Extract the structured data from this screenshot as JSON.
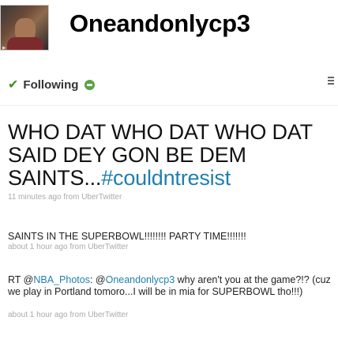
{
  "profile": {
    "username": "Oneandonlycp3",
    "following_label": "Following"
  },
  "tweets": [
    {
      "prefix": "WHO DAT WHO DAT WHO DAT SAID DEY GON BE DEM SAINTS...",
      "hashtag": "#couldntresist",
      "time": "11 minutes ago from",
      "source": "UberTwitter"
    },
    {
      "text": "SAINTS IN THE SUPERBOWL!!!!!!!! PARTY TIME!!!!!!!",
      "time": "about 1 hour ago from",
      "source": "UberTwitter"
    },
    {
      "rt": "RT @",
      "mention1": "NBA_Photos",
      "mid": ": @",
      "mention2": "Oneandonlycp3",
      "rest": " why aren't you at the game?!? (cuz we play in Portland tomoro...I will be in mia for SUPERBOWL tho!!!)",
      "time": "about 1 hour ago from",
      "source": "UberTwitter"
    }
  ]
}
